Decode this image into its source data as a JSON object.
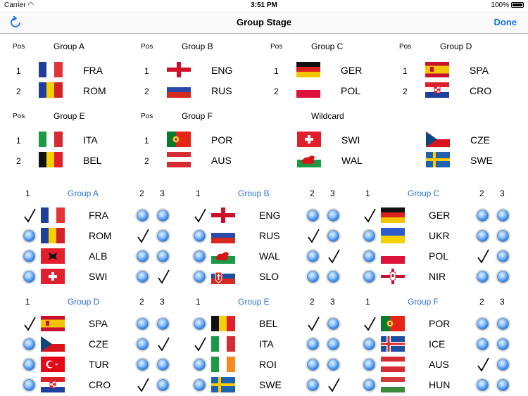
{
  "status": {
    "carrier": "Carrier",
    "time": "3:51 PM",
    "battery": "100%"
  },
  "nav": {
    "title": "Group Stage",
    "done": "Done"
  },
  "summary": {
    "pos_label": "Pos",
    "groups": [
      {
        "name": "Group A",
        "rows": [
          {
            "pos": "1",
            "code": "FRA",
            "flag": "fra"
          },
          {
            "pos": "2",
            "code": "ROM",
            "flag": "rom"
          }
        ]
      },
      {
        "name": "Group B",
        "rows": [
          {
            "pos": "1",
            "code": "ENG",
            "flag": "eng"
          },
          {
            "pos": "2",
            "code": "RUS",
            "flag": "rus"
          }
        ]
      },
      {
        "name": "Group C",
        "rows": [
          {
            "pos": "1",
            "code": "GER",
            "flag": "ger"
          },
          {
            "pos": "2",
            "code": "POL",
            "flag": "pol"
          }
        ]
      },
      {
        "name": "Group D",
        "rows": [
          {
            "pos": "1",
            "code": "SPA",
            "flag": "spa"
          },
          {
            "pos": "2",
            "code": "CRO",
            "flag": "cro"
          }
        ]
      },
      {
        "name": "Group E",
        "rows": [
          {
            "pos": "1",
            "code": "ITA",
            "flag": "ita"
          },
          {
            "pos": "2",
            "code": "BEL",
            "flag": "bel"
          }
        ]
      },
      {
        "name": "Group F",
        "rows": [
          {
            "pos": "1",
            "code": "POR",
            "flag": "por"
          },
          {
            "pos": "2",
            "code": "AUS",
            "flag": "aus"
          }
        ]
      }
    ],
    "wildcard": {
      "name": "Wildcard",
      "teams": [
        {
          "code": "SWI",
          "flag": "swi"
        },
        {
          "code": "WAL",
          "flag": "wal"
        },
        {
          "code": "CZE",
          "flag": "cze"
        },
        {
          "code": "SWE",
          "flag": "swe"
        }
      ]
    }
  },
  "selection": {
    "col_labels": [
      "1",
      "2",
      "3"
    ],
    "groups": [
      {
        "name": "Group A",
        "teams": [
          {
            "code": "FRA",
            "flag": "fra",
            "sel": [
              1,
              0,
              0
            ]
          },
          {
            "code": "ROM",
            "flag": "rom",
            "sel": [
              0,
              1,
              0
            ]
          },
          {
            "code": "ALB",
            "flag": "alb",
            "sel": [
              0,
              0,
              0
            ]
          },
          {
            "code": "SWI",
            "flag": "swi",
            "sel": [
              0,
              0,
              1
            ]
          }
        ]
      },
      {
        "name": "Group B",
        "teams": [
          {
            "code": "ENG",
            "flag": "eng",
            "sel": [
              1,
              0,
              0
            ]
          },
          {
            "code": "RUS",
            "flag": "rus",
            "sel": [
              0,
              1,
              0
            ]
          },
          {
            "code": "WAL",
            "flag": "wal",
            "sel": [
              0,
              0,
              1
            ]
          },
          {
            "code": "SLO",
            "flag": "slo",
            "sel": [
              0,
              0,
              0
            ]
          }
        ]
      },
      {
        "name": "Group C",
        "teams": [
          {
            "code": "GER",
            "flag": "ger",
            "sel": [
              1,
              0,
              0
            ]
          },
          {
            "code": "UKR",
            "flag": "ukr",
            "sel": [
              0,
              0,
              0
            ]
          },
          {
            "code": "POL",
            "flag": "pol",
            "sel": [
              0,
              1,
              0
            ]
          },
          {
            "code": "NIR",
            "flag": "nir",
            "sel": [
              0,
              0,
              0
            ]
          }
        ]
      },
      {
        "name": "Group D",
        "teams": [
          {
            "code": "SPA",
            "flag": "spa",
            "sel": [
              1,
              0,
              0
            ]
          },
          {
            "code": "CZE",
            "flag": "cze",
            "sel": [
              0,
              0,
              1
            ]
          },
          {
            "code": "TUR",
            "flag": "tur",
            "sel": [
              0,
              0,
              0
            ]
          },
          {
            "code": "CRO",
            "flag": "cro",
            "sel": [
              0,
              1,
              0
            ]
          }
        ]
      },
      {
        "name": "Group E",
        "teams": [
          {
            "code": "BEL",
            "flag": "bel",
            "sel": [
              0,
              1,
              0
            ]
          },
          {
            "code": "ITA",
            "flag": "ita",
            "sel": [
              1,
              0,
              0
            ]
          },
          {
            "code": "ROI",
            "flag": "roi",
            "sel": [
              0,
              0,
              0
            ]
          },
          {
            "code": "SWE",
            "flag": "swe",
            "sel": [
              0,
              0,
              1
            ]
          }
        ]
      },
      {
        "name": "Group F",
        "teams": [
          {
            "code": "POR",
            "flag": "por",
            "sel": [
              1,
              0,
              0
            ]
          },
          {
            "code": "ICE",
            "flag": "ice",
            "sel": [
              0,
              0,
              0
            ]
          },
          {
            "code": "AUS",
            "flag": "aus",
            "sel": [
              0,
              1,
              0
            ]
          },
          {
            "code": "HUN",
            "flag": "hun",
            "sel": [
              0,
              0,
              0
            ]
          }
        ]
      }
    ]
  },
  "colors": {
    "accent": "#1a73e8",
    "group_title": "#2b6fd8"
  }
}
